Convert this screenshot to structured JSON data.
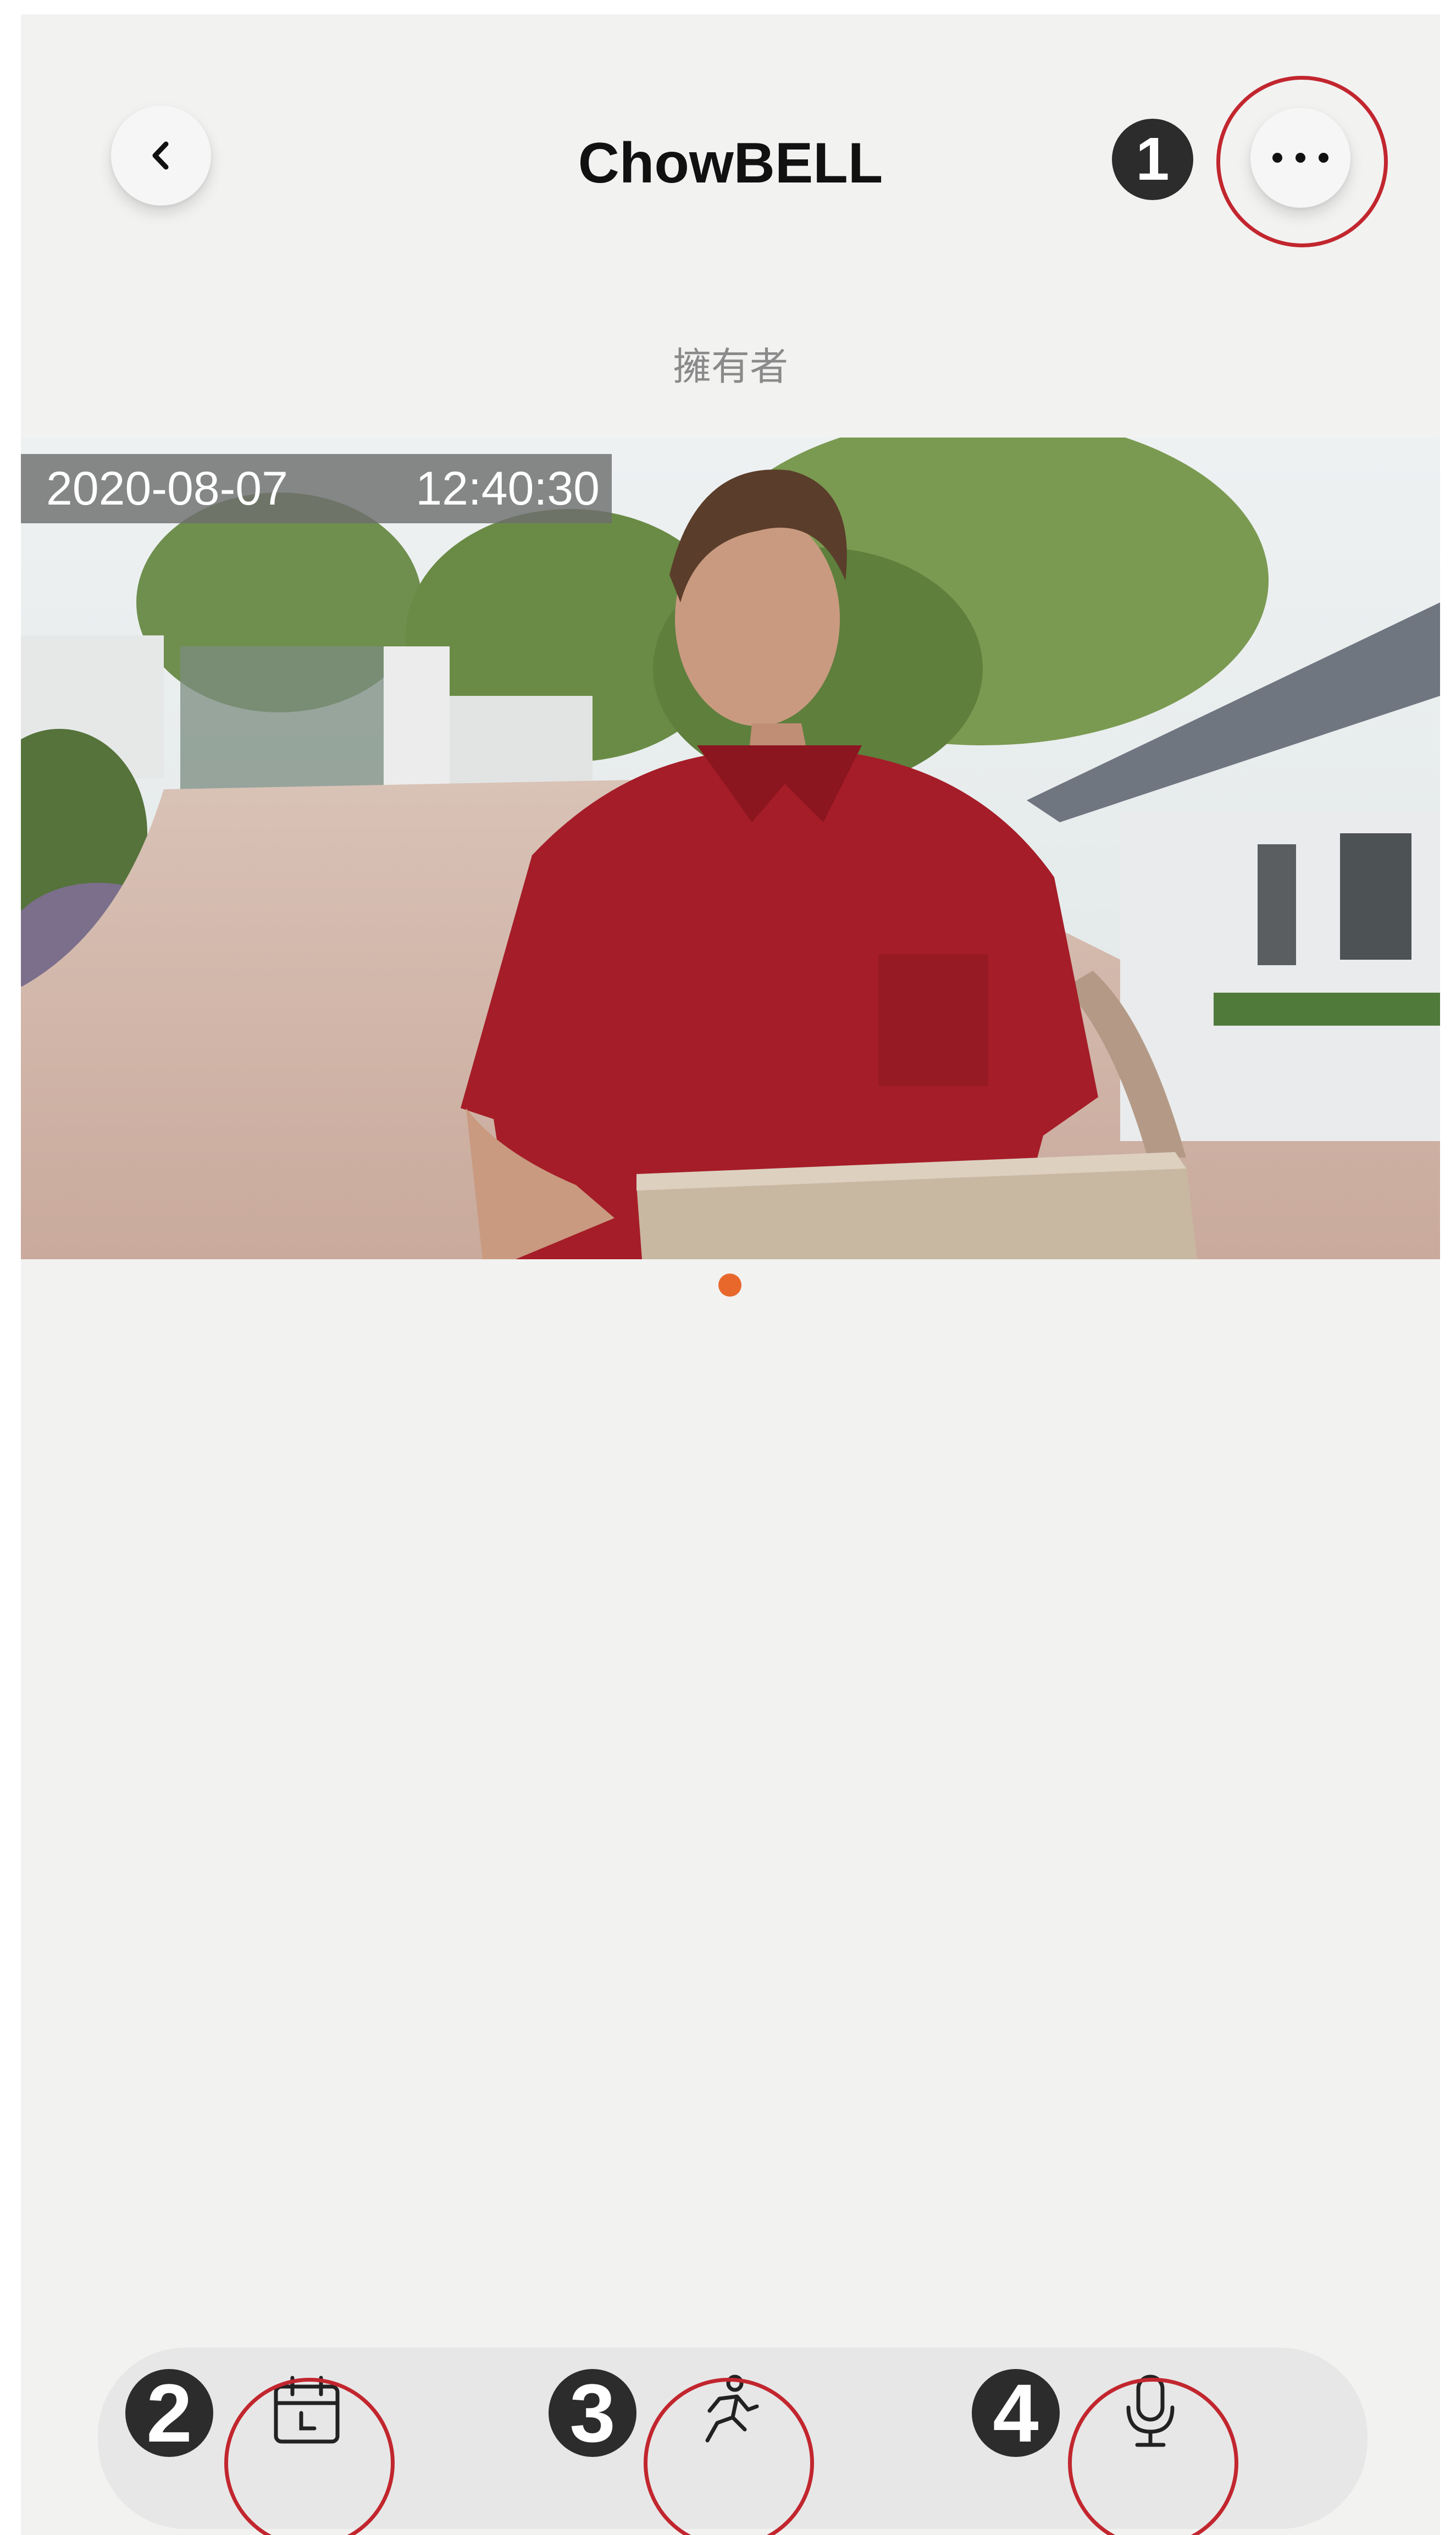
{
  "header": {
    "back_icon": "chevron-left-icon",
    "title": "ChowBELL",
    "more_icon": "more-horizontal-icon",
    "subtitle": "擁有者"
  },
  "camera": {
    "date": "2020-08-07",
    "time": "12:40:30"
  },
  "pager": {
    "pages": 1,
    "active": 1
  },
  "toolbar": {
    "buttons": [
      {
        "icon": "calendar-clock-icon",
        "label": "playback"
      },
      {
        "icon": "motion-running-icon",
        "label": "motion"
      },
      {
        "icon": "microphone-icon",
        "label": "talk"
      }
    ]
  },
  "annotations": {
    "marker_1": "1",
    "marker_2": "2",
    "marker_3": "3",
    "marker_4": "4",
    "ring_color": "#c2262e",
    "accent": "#e8682c"
  }
}
